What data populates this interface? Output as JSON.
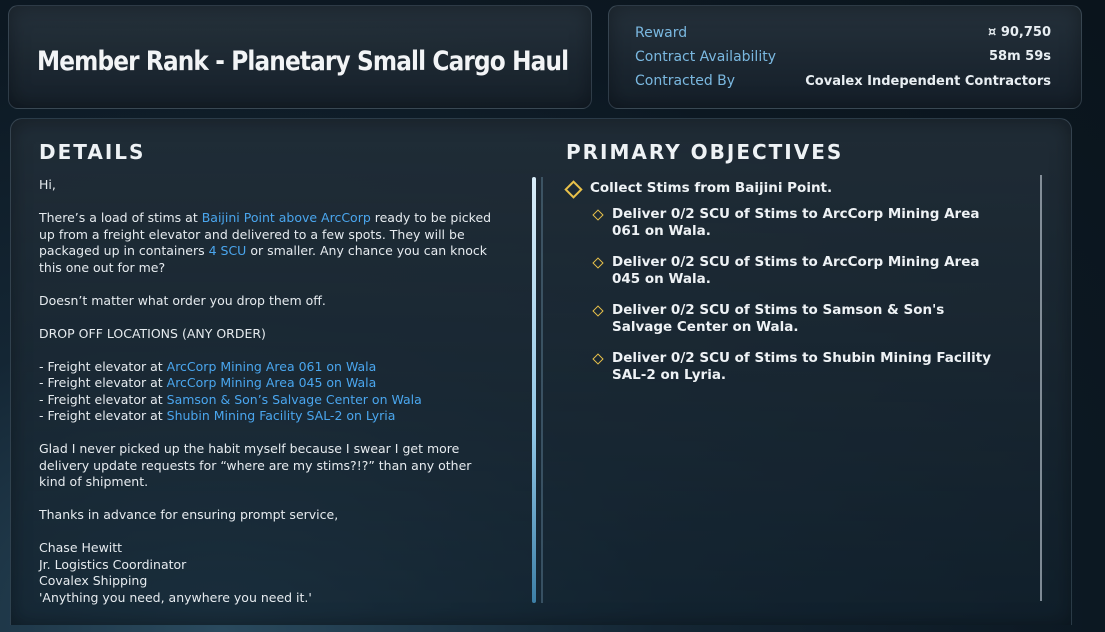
{
  "header": {
    "title": "Member Rank - Planetary Small Cargo Haul"
  },
  "contract_info": {
    "reward_label": "Reward",
    "reward_value": "¤ 90,750",
    "availability_label": "Contract Availability",
    "availability_value": "58m 59s",
    "contracted_by_label": "Contracted By",
    "contracted_by_value": "Covalex Independent Contractors"
  },
  "details": {
    "heading": "DETAILS",
    "greeting": "Hi,",
    "p1_a": "There’s a load of stims at ",
    "p1_link1": "Baijini Point above ArcCorp",
    "p1_b": " ready to be picked up from a freight elevator and delivered to a few spots. They will be packaged up in containers ",
    "p1_link2": "4 SCU",
    "p1_c": " or smaller. Any chance you can knock this one out for me?",
    "p2": "Doesn’t matter what order you drop them off.",
    "p3": "DROP OFF LOCATIONS (ANY ORDER)",
    "locations": [
      {
        "prefix": "- Freight elevator at ",
        "place": "ArcCorp Mining Area 061 on Wala"
      },
      {
        "prefix": "- Freight elevator at ",
        "place": "ArcCorp Mining Area 045 on Wala"
      },
      {
        "prefix": "- Freight elevator at ",
        "place": "Samson & Son’s Salvage Center on Wala"
      },
      {
        "prefix": "- Freight elevator at ",
        "place": "Shubin Mining Facility SAL-2 on Lyria"
      }
    ],
    "p4": "Glad I never picked up the habit myself because I swear I get more delivery update requests for “where are my stims?!?” than any other kind of shipment.",
    "p5": "Thanks in advance for ensuring prompt service,",
    "sig_name": "Chase Hewitt",
    "sig_title": "Jr. Logistics Coordinator",
    "sig_company": "Covalex Shipping",
    "sig_tagline": "'Anything you need, anywhere you need it.'"
  },
  "objectives": {
    "heading": "PRIMARY OBJECTIVES",
    "main": "Collect Stims from Baijini Point.",
    "subs": [
      "Deliver 0/2 SCU of Stims to ArcCorp Mining Area 061 on Wala.",
      "Deliver 0/2 SCU of Stims to ArcCorp Mining Area 045 on Wala.",
      "Deliver 0/2 SCU of Stims to Samson & Son's Salvage Center on Wala.",
      "Deliver 0/2 SCU of Stims to Shubin Mining Facility SAL-2 on Lyria."
    ]
  },
  "colors": {
    "accent_link": "#4aa6ee",
    "objective_marker": "#e8c14a",
    "label": "#7ab8e0"
  }
}
